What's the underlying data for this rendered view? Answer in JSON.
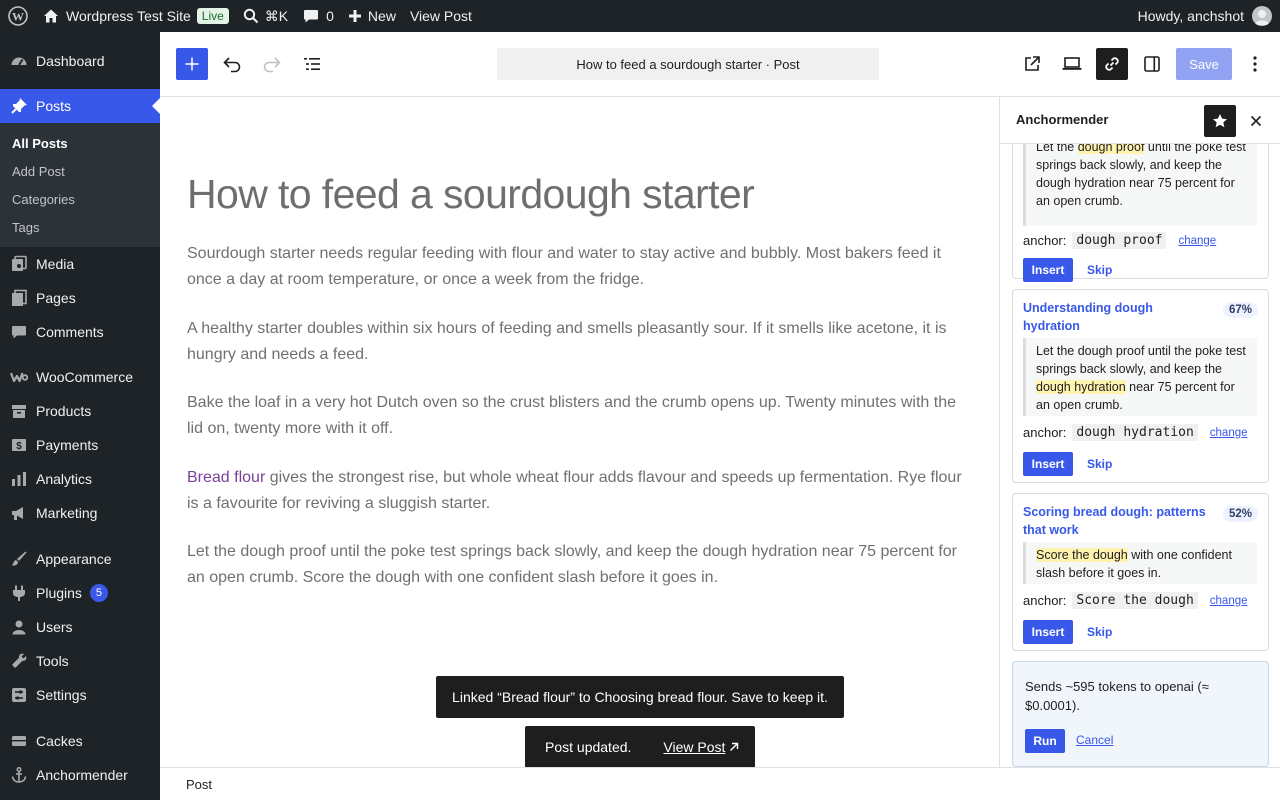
{
  "adminbar": {
    "site_name": "Wordpress Test Site",
    "live_badge": "Live",
    "search_shortcut": "⌘K",
    "comments_count": "0",
    "new_label": "New",
    "view_post_label": "View Post",
    "howdy": "Howdy, anchshot"
  },
  "sidebar": {
    "dashboard": "Dashboard",
    "posts": "Posts",
    "posts_sub": [
      "All Posts",
      "Add Post",
      "Categories",
      "Tags"
    ],
    "media": "Media",
    "pages": "Pages",
    "comments": "Comments",
    "woocommerce": "WooCommerce",
    "products": "Products",
    "payments": "Payments",
    "analytics": "Analytics",
    "marketing": "Marketing",
    "appearance": "Appearance",
    "plugins": "Plugins",
    "plugins_badge": "5",
    "users": "Users",
    "tools": "Tools",
    "settings": "Settings",
    "cackes": "Cackes",
    "anchormender": "Anchormender"
  },
  "toolbar": {
    "doc_title": "How to feed a sourdough starter · Post",
    "save_label": "Save"
  },
  "post": {
    "title": "How to feed a sourdough starter",
    "p1": "Sourdough starter needs regular feeding with flour and water to stay active and bubbly. Most bakers feed it once a day at room temperature, or once a week from the fridge.",
    "p2": "A healthy starter doubles within six hours of feeding and smells pleasantly sour. If it smells like acetone, it is hungry and needs a feed.",
    "p3": "Bake the loaf in a very hot Dutch oven so the crust blisters and the crumb opens up. Twenty minutes with the lid on, twenty more with it off.",
    "p4_link": "Bread flour",
    "p4_rest": " gives the strongest rise, but whole wheat flour adds flavour and speeds up fermentation. Rye flour is a favourite for reviving a sluggish starter.",
    "p5": "Let the dough proof until the poke test springs back slowly, and keep the dough hydration near 75 percent for an open crumb. Score the dough with one confident slash before it goes in."
  },
  "notices": {
    "linked": "Linked “Bread flour” to Choosing bread flour. Save to keep it.",
    "updated": "Post updated.",
    "view_post": "View Post"
  },
  "footer": {
    "breadcrumb": "Post"
  },
  "panel": {
    "title": "Anchormender",
    "anchor_label": "anchor:",
    "change_label": "change",
    "insert_label": "Insert",
    "skip_label": "Skip",
    "cards": [
      {
        "excerpt_pre": "Let the ",
        "excerpt_hl": "dough proof",
        "excerpt_post": " until the poke test springs back slowly, and keep the dough hydration near 75 percent for an open crumb.",
        "anchor": "dough proof"
      },
      {
        "title": "Understanding dough hydration",
        "score": "67%",
        "excerpt_pre": "Let the dough proof until the poke test springs back slowly, and keep the ",
        "excerpt_hl": "dough hydration",
        "excerpt_post": " near 75 percent for an open crumb.",
        "anchor": "dough hydration"
      },
      {
        "title": "Scoring bread dough: patterns that work",
        "score": "52%",
        "excerpt_pre": "",
        "excerpt_hl": "Score the dough",
        "excerpt_post": " with one confident slash before it goes in.",
        "anchor": "Score the dough"
      }
    ],
    "run_box": {
      "text": "Sends ~595 tokens to openai (≈ $0.0001).",
      "run_label": "Run",
      "cancel_label": "Cancel"
    }
  },
  "colors": {
    "admin_dark": "#1d2327",
    "accent": "#3858e9",
    "highlight": "#fff3b0",
    "link_visited": "#7a3f99"
  }
}
